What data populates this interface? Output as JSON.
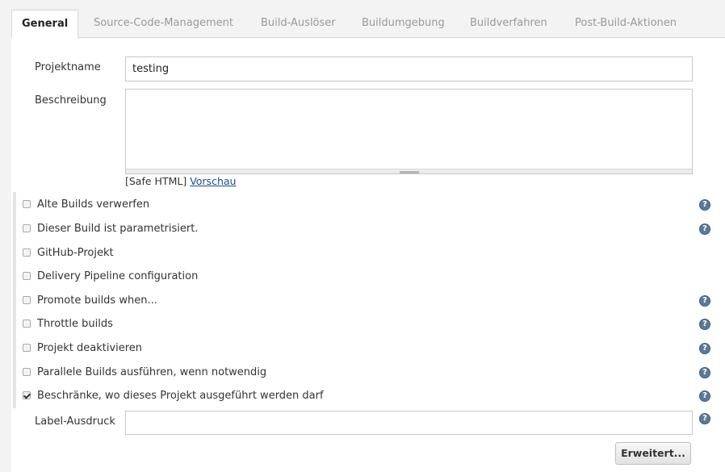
{
  "tabs": [
    {
      "label": "General",
      "active": true
    },
    {
      "label": "Source-Code-Management"
    },
    {
      "label": "Build-Auslöser"
    },
    {
      "label": "Buildumgebung"
    },
    {
      "label": "Buildverfahren"
    },
    {
      "label": "Post-Build-Aktionen"
    }
  ],
  "form": {
    "project_name_label": "Projektname",
    "project_name_value": "testing",
    "description_label": "Beschreibung",
    "description_value": "",
    "safe_html_prefix": "[Safe HTML]",
    "preview_link": "Vorschau",
    "label_expression_label": "Label-Ausdruck",
    "label_expression_value": "",
    "advanced_button": "Erweitert..."
  },
  "options": [
    {
      "label": "Alte Builds verwerfen",
      "checked": false,
      "help": true
    },
    {
      "label": "Dieser Build ist parametrisiert.",
      "checked": false,
      "help": true
    },
    {
      "label": "GitHub-Projekt",
      "checked": false,
      "help": false
    },
    {
      "label": "Delivery Pipeline configuration",
      "checked": false,
      "help": false
    },
    {
      "label": "Promote builds when...",
      "checked": false,
      "help": true
    },
    {
      "label": "Throttle builds",
      "checked": false,
      "help": true
    },
    {
      "label": "Projekt deaktivieren",
      "checked": false,
      "help": true
    },
    {
      "label": "Parallele Builds ausführen, wenn notwendig",
      "checked": false,
      "help": true
    },
    {
      "label": "Beschränke, wo dieses Projekt ausgeführt werden darf",
      "checked": true,
      "help": true
    }
  ],
  "help_icon_text": "?",
  "colors": {
    "help_icon": "#5b7a9a",
    "link": "#204a87"
  }
}
